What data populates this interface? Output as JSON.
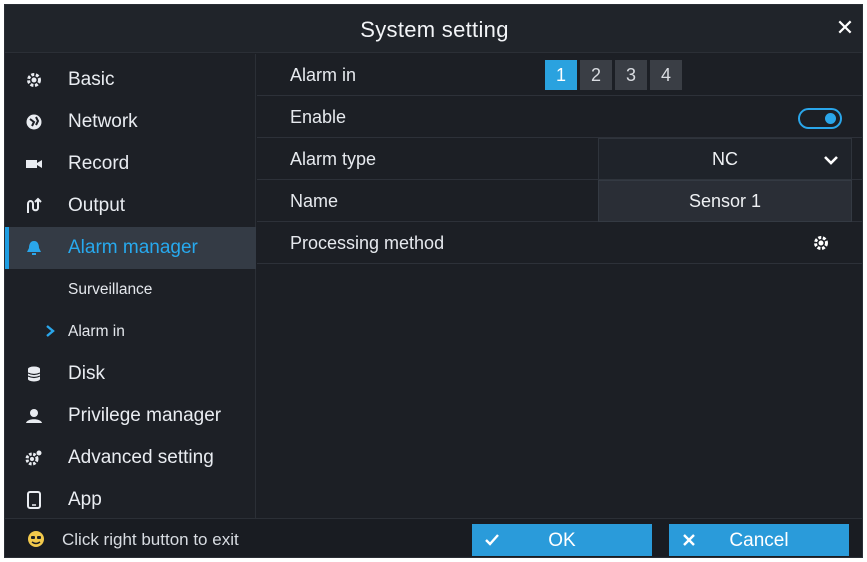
{
  "window": {
    "title": "System setting"
  },
  "sidebar": {
    "items": [
      {
        "label": "Basic",
        "icon": "gear-icon"
      },
      {
        "label": "Network",
        "icon": "globe-icon"
      },
      {
        "label": "Record",
        "icon": "camera-icon"
      },
      {
        "label": "Output",
        "icon": "output-icon"
      },
      {
        "label": "Alarm manager",
        "icon": "bell-icon",
        "active": true
      },
      {
        "label": "Surveillance",
        "sub": true
      },
      {
        "label": "Alarm in",
        "sub": true,
        "current": true
      },
      {
        "label": "Disk",
        "icon": "database-icon"
      },
      {
        "label": "Privilege manager",
        "icon": "user-icon"
      },
      {
        "label": "Advanced setting",
        "icon": "gears-icon"
      },
      {
        "label": "App",
        "icon": "phone-icon"
      }
    ]
  },
  "content": {
    "alarm_in": {
      "label": "Alarm in",
      "tabs": [
        "1",
        "2",
        "3",
        "4"
      ],
      "selected": "1"
    },
    "enable": {
      "label": "Enable",
      "value": true
    },
    "alarm_type": {
      "label": "Alarm type",
      "value": "NC"
    },
    "name": {
      "label": "Name",
      "value": "Sensor 1"
    },
    "processing": {
      "label": "Processing method"
    }
  },
  "footer": {
    "hint": "Click right button to exit",
    "ok_label": "OK",
    "cancel_label": "Cancel"
  },
  "colors": {
    "accent": "#2aa2df",
    "active_text": "#27a9ee",
    "background": "#1c1f25"
  }
}
